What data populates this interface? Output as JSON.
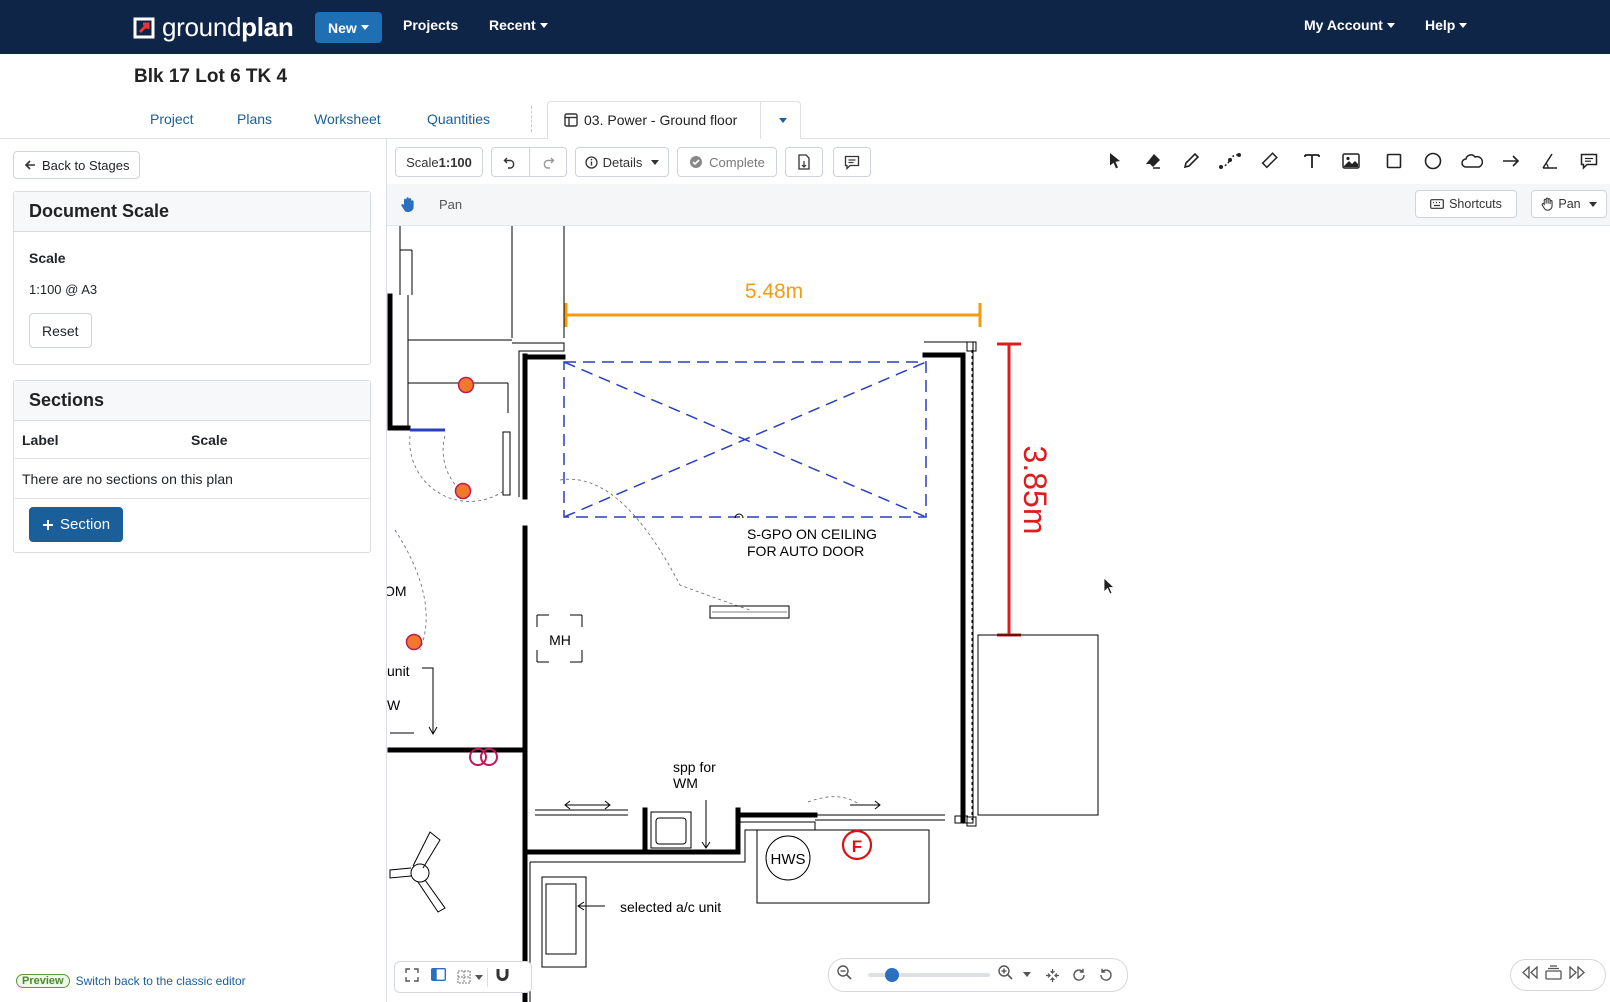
{
  "app": {
    "brand_light": "ground",
    "brand_bold": "plan",
    "nav": {
      "new_label": "New",
      "projects": "Projects",
      "recent": "Recent",
      "account": "My Account",
      "help": "Help"
    }
  },
  "project": {
    "title": "Blk 17 Lot 6 TK 4",
    "tabs": [
      "Project",
      "Plans",
      "Worksheet",
      "Quantities"
    ],
    "plan_tab": "03. Power - Ground floor"
  },
  "left": {
    "back_label": "Back to Stages",
    "doc_scale": {
      "title": "Document Scale",
      "scale_label": "Scale",
      "scale_value": "1:100 @ A3",
      "reset_label": "Reset"
    },
    "sections": {
      "title": "Sections",
      "col_label": "Label",
      "col_scale": "Scale",
      "empty": "There are no sections on this plan",
      "add_label": "Section"
    },
    "preview_badge": "Preview",
    "preview_link": "Switch back to the classic editor"
  },
  "toolbar": {
    "scale_prefix": "Scale ",
    "scale_value": "1:100",
    "details_label": "Details",
    "complete_label": "Complete",
    "tools": [
      "select-icon",
      "eraser-icon",
      "pencil-icon",
      "polyline-icon",
      "ruler-icon",
      "text-icon",
      "image-icon",
      "rectangle-icon",
      "circle-icon",
      "cloud-icon",
      "arrow-icon",
      "angle-icon",
      "comment-icon"
    ]
  },
  "subbar": {
    "mode_label": "Pan",
    "shortcuts_label": "Shortcuts",
    "pan_label": "Pan"
  },
  "drawing": {
    "dim_horizontal": "5.48m",
    "dim_vertical": "3.85m",
    "note_line1": "S-GPO ON CEILING",
    "note_line2": "FOR AUTO DOOR",
    "mh": "MH",
    "spp_line1": "spp for",
    "spp_line2": "WM",
    "hws": "HWS",
    "fire": "F",
    "ac_unit": "selected a/c unit",
    "room_frag": "OM",
    "unit_frag": "unit",
    "w_frag": "W",
    "colors": {
      "dim_orange": "#f39c12",
      "dim_red": "#e01b1b",
      "garage_blue": "#2a3fbf",
      "wall": "#000000"
    }
  },
  "zoom": {
    "level": 0.15
  }
}
